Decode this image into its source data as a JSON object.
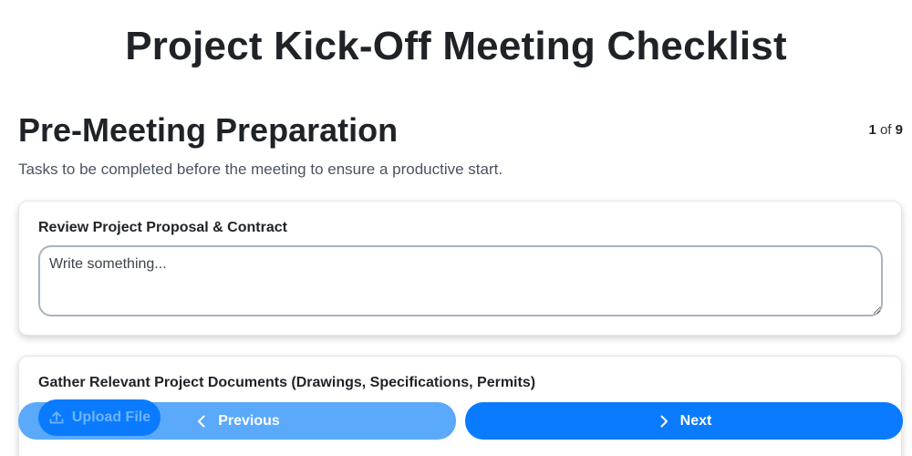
{
  "document": {
    "title": "Project Kick-Off Meeting Checklist"
  },
  "section": {
    "title": "Pre-Meeting Preparation",
    "description": "Tasks to be completed before the meeting to ensure a productive start.",
    "pager": {
      "current": "1",
      "separator": "of",
      "total": "9"
    }
  },
  "tasks": [
    {
      "label": "Review Project Proposal & Contract",
      "input_placeholder": "Write something...",
      "input_value": ""
    },
    {
      "label": "Gather Relevant Project Documents (Drawings, Specifications, Permits)",
      "upload_label": "Upload File",
      "upload_icon": "upload-icon"
    }
  ],
  "navigation": {
    "previous_label": "Previous",
    "previous_icon": "chevron-left-icon",
    "next_label": "Next",
    "next_icon": "chevron-right-icon"
  },
  "colors": {
    "primary": "#0a7bff",
    "primary_light": "#5aa9fb",
    "text_dark": "#1f2328",
    "text_muted": "#4a5360"
  }
}
